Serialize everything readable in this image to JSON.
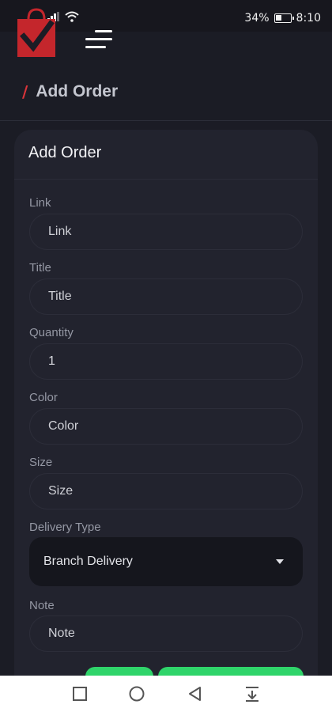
{
  "status_bar": {
    "battery": "34%",
    "time": "8:10"
  },
  "header": {
    "logo_icon": "shopping-bag-check-logo",
    "menu_icon": "hamburger-menu-icon",
    "brand_color": "#d9343a"
  },
  "breadcrumb": {
    "separator": "/",
    "current": "Add Order"
  },
  "form": {
    "title": "Add Order",
    "fields": [
      {
        "label": "Link",
        "placeholder": "Link",
        "value": ""
      },
      {
        "label": "Title",
        "placeholder": "Title",
        "value": ""
      },
      {
        "label": "Quantity",
        "placeholder": "",
        "value": "1"
      },
      {
        "label": "Color",
        "placeholder": "Color",
        "value": ""
      },
      {
        "label": "Size",
        "placeholder": "Size",
        "value": ""
      }
    ],
    "delivery": {
      "label": "Delivery Type",
      "selected": "Branch Delivery"
    },
    "note": {
      "label": "Note",
      "placeholder": "Note"
    },
    "accent_color": "#2fd46a"
  },
  "nav_bar": {
    "icons": [
      "recent-apps-icon",
      "home-icon",
      "back-icon",
      "notification-pull-icon"
    ]
  }
}
